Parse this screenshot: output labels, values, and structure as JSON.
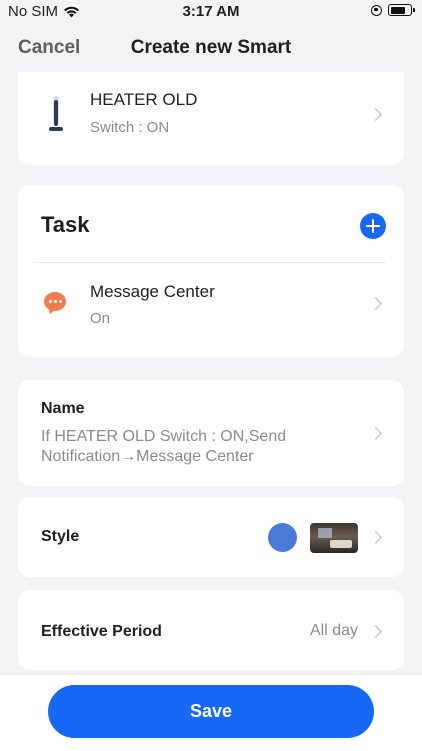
{
  "status": {
    "carrier": "No SIM",
    "time": "3:17 AM"
  },
  "nav": {
    "cancel_label": "Cancel",
    "title": "Create new Smart"
  },
  "condition": {
    "device_name": "HEATER OLD",
    "device_status": "Switch : ON",
    "icon": "heater-icon"
  },
  "task": {
    "title": "Task",
    "items": [
      {
        "name": "Message Center",
        "status": "On",
        "icon": "message-icon"
      }
    ]
  },
  "name_section": {
    "label": "Name",
    "value": "If HEATER OLD Switch : ON,Send Notification→Message Center"
  },
  "style_section": {
    "label": "Style",
    "color": "#4a7ad8"
  },
  "period_section": {
    "label": "Effective Period",
    "value": "All day"
  },
  "save_label": "Save",
  "colors": {
    "accent": "#1668f5",
    "message_icon": "#f37c4d",
    "background": "#f2f3f5"
  }
}
